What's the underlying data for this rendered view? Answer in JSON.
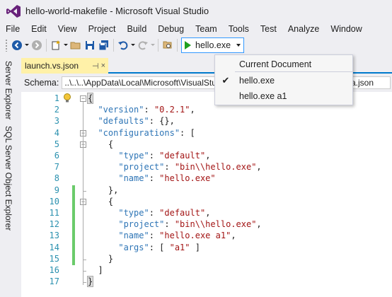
{
  "window": {
    "title": "hello-world-makefile - Microsoft Visual Studio"
  },
  "menu": [
    "File",
    "Edit",
    "View",
    "Project",
    "Build",
    "Debug",
    "Team",
    "Tools",
    "Test",
    "Analyze",
    "Window"
  ],
  "toolbar": {
    "debug_target": "hello.exe"
  },
  "sidebar": {
    "tabs": [
      "Server Explorer",
      "SQL Server Object Explorer"
    ]
  },
  "editor": {
    "tab_name": "launch.vs.json",
    "pin_glyph": "⊣",
    "close_glyph": "×",
    "schema_label": "Schema:",
    "schema_value": "..\\..\\..\\AppData\\Local\\Microsoft\\VisualStudio\\15.0\\OpenFolder\\launch_schema.json",
    "line_numbers": [
      "1",
      "2",
      "3",
      "4",
      "5",
      "6",
      "7",
      "8",
      "9",
      "10",
      "11",
      "12",
      "13",
      "14",
      "15",
      "16",
      "17"
    ],
    "code": [
      [
        {
          "t": "p",
          "v": "{"
        }
      ],
      [
        {
          "t": "k",
          "v": "  \"version\""
        },
        {
          "t": "p",
          "v": ": "
        },
        {
          "t": "s",
          "v": "\"0.2.1\""
        },
        {
          "t": "p",
          "v": ","
        }
      ],
      [
        {
          "t": "k",
          "v": "  \"defaults\""
        },
        {
          "t": "p",
          "v": ": {},"
        }
      ],
      [
        {
          "t": "k",
          "v": "  \"configurations\""
        },
        {
          "t": "p",
          "v": ": ["
        }
      ],
      [
        {
          "t": "p",
          "v": "    {"
        }
      ],
      [
        {
          "t": "k",
          "v": "      \"type\""
        },
        {
          "t": "p",
          "v": ": "
        },
        {
          "t": "s",
          "v": "\"default\""
        },
        {
          "t": "p",
          "v": ","
        }
      ],
      [
        {
          "t": "k",
          "v": "      \"project\""
        },
        {
          "t": "p",
          "v": ": "
        },
        {
          "t": "s",
          "v": "\"bin\\\\hello.exe\""
        },
        {
          "t": "p",
          "v": ","
        }
      ],
      [
        {
          "t": "k",
          "v": "      \"name\""
        },
        {
          "t": "p",
          "v": ": "
        },
        {
          "t": "s",
          "v": "\"hello.exe\""
        }
      ],
      [
        {
          "t": "p",
          "v": "    },"
        }
      ],
      [
        {
          "t": "p",
          "v": "    {"
        }
      ],
      [
        {
          "t": "k",
          "v": "      \"type\""
        },
        {
          "t": "p",
          "v": ": "
        },
        {
          "t": "s",
          "v": "\"default\""
        },
        {
          "t": "p",
          "v": ","
        }
      ],
      [
        {
          "t": "k",
          "v": "      \"project\""
        },
        {
          "t": "p",
          "v": ": "
        },
        {
          "t": "s",
          "v": "\"bin\\\\hello.exe\""
        },
        {
          "t": "p",
          "v": ","
        }
      ],
      [
        {
          "t": "k",
          "v": "      \"name\""
        },
        {
          "t": "p",
          "v": ": "
        },
        {
          "t": "s",
          "v": "\"hello.exe a1\""
        },
        {
          "t": "p",
          "v": ","
        }
      ],
      [
        {
          "t": "k",
          "v": "      \"args\""
        },
        {
          "t": "p",
          "v": ": [ "
        },
        {
          "t": "s",
          "v": "\"a1\""
        },
        {
          "t": "p",
          "v": " ]"
        }
      ],
      [
        {
          "t": "p",
          "v": "    }"
        }
      ],
      [
        {
          "t": "p",
          "v": "  ]"
        }
      ],
      [
        {
          "t": "p",
          "v": "}"
        }
      ]
    ]
  },
  "debug_dropdown": {
    "items": [
      {
        "label": "Current Document",
        "checked": false
      },
      {
        "label": "hello.exe",
        "checked": true
      },
      {
        "label": "hello.exe a1",
        "checked": false
      }
    ],
    "check_glyph": "✔"
  },
  "colors": {
    "accent": "#007acc",
    "vs_purple": "#68217a",
    "json_key": "#2e75b6",
    "json_string": "#a31515",
    "line_number": "#2b91af",
    "change_bar": "#6bcb6b",
    "active_tab": "#fff1a8"
  },
  "icons": [
    "vs-logo-icon",
    "back-icon",
    "forward-icon",
    "new-project-icon",
    "open-icon",
    "save-icon",
    "save-all-icon",
    "undo-icon",
    "redo-icon",
    "find-icon",
    "play-icon",
    "lightbulb-icon"
  ]
}
